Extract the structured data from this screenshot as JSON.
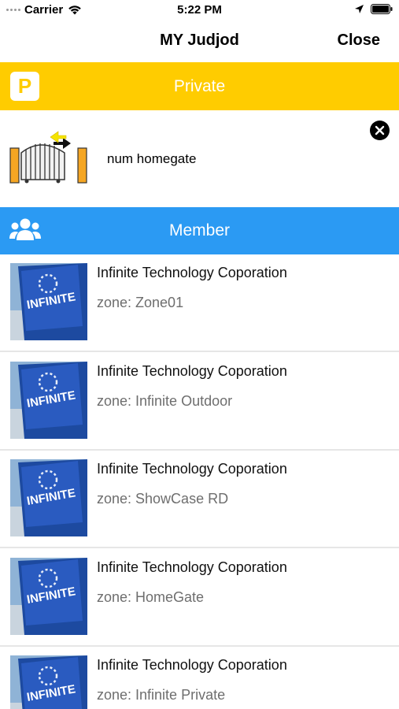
{
  "status_bar": {
    "carrier": "Carrier",
    "time": "5:22 PM",
    "icons": [
      "signal-dots-icon",
      "wifi-icon",
      "location-arrow-icon",
      "battery-icon"
    ]
  },
  "navbar": {
    "title": "MY Judjod",
    "close_label": "Close"
  },
  "private_section": {
    "badge": "P",
    "title": "Private",
    "gate_name": "num homegate",
    "color": "#ffcc00"
  },
  "member_section": {
    "title": "Member",
    "color": "#2b9af3"
  },
  "members": [
    {
      "title": "Infinite Technology Coporation",
      "zone": "zone: Zone01",
      "thumb_text": "INFINITE"
    },
    {
      "title": "Infinite Technology Coporation",
      "zone": "zone: Infinite Outdoor",
      "thumb_text": "INFINITE"
    },
    {
      "title": "Infinite Technology Coporation",
      "zone": "zone: ShowCase RD",
      "thumb_text": "INFINITE"
    },
    {
      "title": "Infinite Technology Coporation",
      "zone": "zone: HomeGate",
      "thumb_text": "INFINITE"
    },
    {
      "title": "Infinite Technology Coporation",
      "zone": "zone: Infinite Private",
      "thumb_text": "INFINITE"
    }
  ]
}
